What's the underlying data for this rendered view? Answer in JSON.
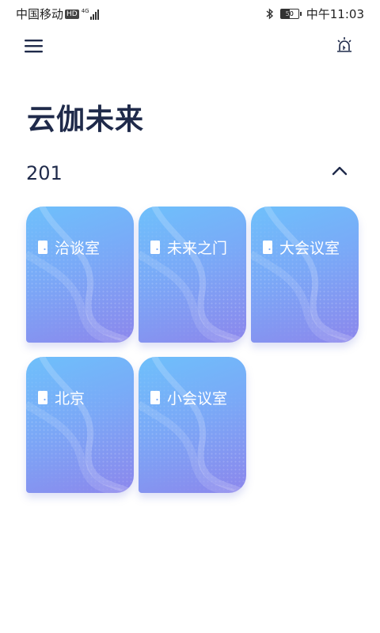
{
  "status_bar": {
    "carrier": "中国移动",
    "hd_badge": "HD",
    "network": "4G",
    "battery": "50",
    "time": "中午11:03"
  },
  "header": {
    "menu_icon": "hamburger-menu-icon",
    "alarm_icon": "alarm-light-icon"
  },
  "page": {
    "title": "云伽未来"
  },
  "section": {
    "title": "201",
    "toggle_icon": "chevron-up-icon",
    "rooms": [
      {
        "name": "洽谈室",
        "icon": "door-icon"
      },
      {
        "name": "未来之门",
        "icon": "door-icon"
      },
      {
        "name": "大会议室",
        "icon": "door-icon"
      },
      {
        "name": "北京",
        "icon": "door-icon"
      },
      {
        "name": "小会议室",
        "icon": "door-icon"
      }
    ]
  },
  "colors": {
    "title": "#1f2a4a",
    "card_top": "#6ec0fb",
    "card_bottom": "#8c86ec",
    "card_text": "#ffffff"
  }
}
